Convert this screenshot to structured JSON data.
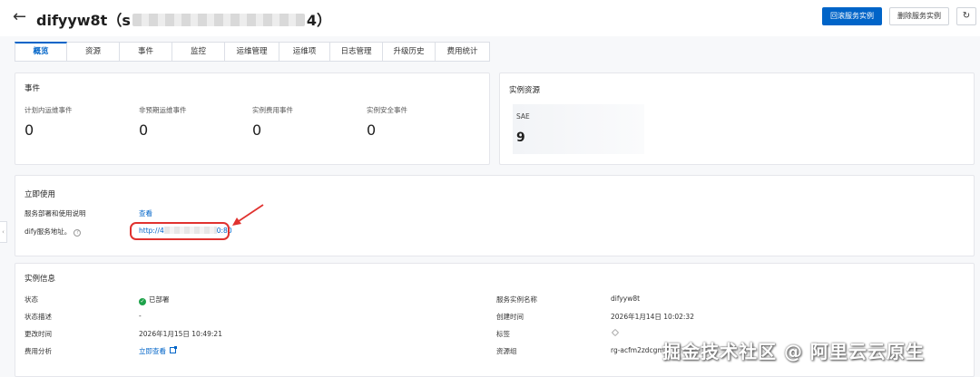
{
  "header": {
    "title_prefix": "difyyw8t（s",
    "title_suffix": "4）",
    "rollback_button": "回滚服务实例",
    "delete_button": "删除服务实例"
  },
  "tabs": [
    {
      "label": "概览",
      "active": true
    },
    {
      "label": "资源"
    },
    {
      "label": "事件"
    },
    {
      "label": "监控"
    },
    {
      "label": "运维管理"
    },
    {
      "label": "运维项"
    },
    {
      "label": "日志管理"
    },
    {
      "label": "升级历史"
    },
    {
      "label": "费用统计"
    }
  ],
  "events": {
    "title": "事件",
    "items": [
      {
        "label": "计划内运维事件",
        "value": "0"
      },
      {
        "label": "非预期运维事件",
        "value": "0"
      },
      {
        "label": "实例费用事件",
        "value": "0"
      },
      {
        "label": "实例安全事件",
        "value": "0"
      }
    ]
  },
  "resources": {
    "title": "实例资源",
    "label": "SAE",
    "value": "9"
  },
  "usage": {
    "title": "立即使用",
    "deploy_label": "服务部署和使用说明",
    "deploy_link": "查看",
    "address_label": "dify服务地址。",
    "address_prefix": "http://4",
    "address_suffix": "0:80"
  },
  "info": {
    "title": "实例信息",
    "left": [
      {
        "label": "状态",
        "value": "已部署"
      },
      {
        "label": "状态描述",
        "value": "-"
      },
      {
        "label": "更改时间",
        "value": "2026年1月15日 10:49:21"
      },
      {
        "label": "费用分析",
        "value": "立即查看"
      }
    ],
    "right": [
      {
        "label": "服务实例名称",
        "value": "difyyw8t"
      },
      {
        "label": "创建时间",
        "value": "2026年1月14日 10:02:32"
      },
      {
        "label": "标签",
        "value": ""
      },
      {
        "label": "资源组",
        "value": "rg-acfm2zdcgm"
      }
    ]
  },
  "watermark": "掘金技术社区 @ 阿里云云原生",
  "colors": {
    "primary": "#0064c8",
    "success": "#1ea24a",
    "highlight": "#e0322f"
  }
}
